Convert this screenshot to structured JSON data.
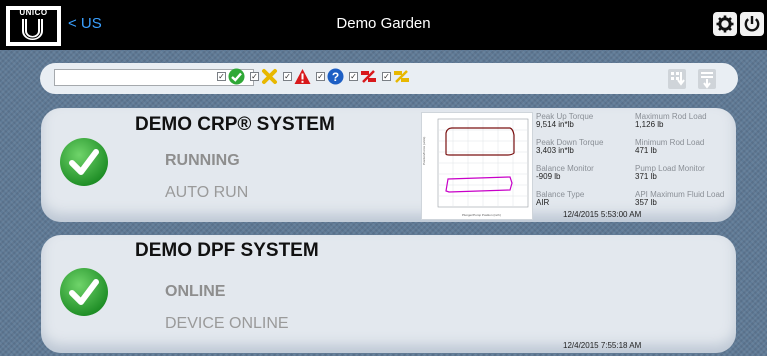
{
  "header": {
    "logo_text": "UNICO",
    "back_label": "< US",
    "title": "Demo Garden",
    "settings_icon": "gear-icon",
    "power_icon": "power-icon"
  },
  "filter_bar": {
    "search_value": "",
    "filters": [
      {
        "name": "running",
        "icon": "green-check-icon",
        "checked": true
      },
      {
        "name": "stopped",
        "icon": "yellow-x-icon",
        "checked": true
      },
      {
        "name": "alarm",
        "icon": "red-warning-icon",
        "checked": true
      },
      {
        "name": "unknown",
        "icon": "blue-question-icon",
        "checked": true
      },
      {
        "name": "comm-fault",
        "icon": "red-link-icon",
        "checked": true
      },
      {
        "name": "other",
        "icon": "yellow-link-icon",
        "checked": true
      }
    ],
    "right_icons": [
      "sort-down-icon",
      "sort-list-icon"
    ]
  },
  "systems": [
    {
      "name": "DEMO CRP® SYSTEM",
      "state": "RUNNING",
      "substate": "AUTO RUN",
      "status_icon": "green-check-icon",
      "metrics": [
        {
          "label": "Peak Up Torque",
          "value": "9,514 in*lb"
        },
        {
          "label": "Maximum Rod Load",
          "value": "1,126 lb"
        },
        {
          "label": "Peak Down Torque",
          "value": "3,403 in*lb"
        },
        {
          "label": "Minimum Rod Load",
          "value": "471 lb"
        },
        {
          "label": "Balance Monitor",
          "value": "-909 lb"
        },
        {
          "label": "Pump Load Monitor",
          "value": "371 lb"
        },
        {
          "label": "Balance Type",
          "value": "AIR"
        },
        {
          "label": "API Maximum Fluid Load",
          "value": "357 lb"
        }
      ],
      "timestamp": "12/4/2015 5:53:00 AM"
    },
    {
      "name": "DEMO DPF SYSTEM",
      "state": "ONLINE",
      "substate": "DEVICE ONLINE",
      "status_icon": "green-check-icon",
      "timestamp": "12/4/2015 7:55:18 AM"
    }
  ],
  "colors": {
    "background": "#5f7a96",
    "header": "#000000",
    "back_link": "#3aa0ff",
    "card": "#e3e8ee",
    "status_green": "#2fa836",
    "surface_card": "#7a1010",
    "pump_card": "#c800c8"
  }
}
